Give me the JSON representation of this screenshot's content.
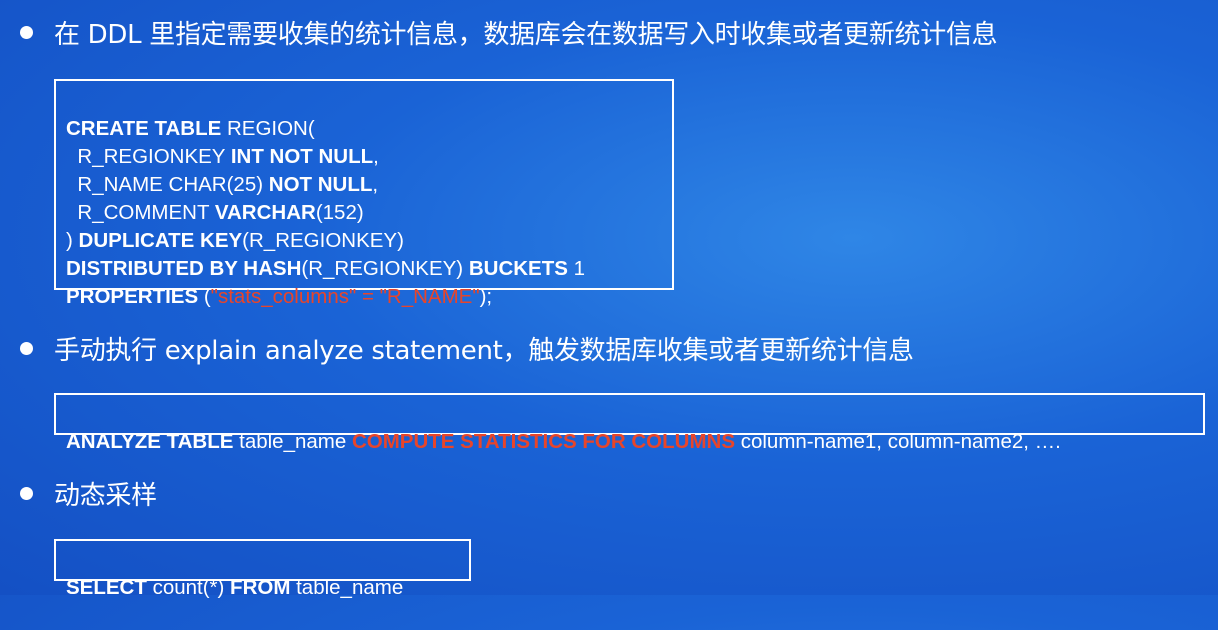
{
  "bullets": [
    "在 DDL 里指定需要收集的统计信息，数据库会在数据写入时收集或者更新统计信息",
    "手动执行 explain analyze statement，触发数据库收集或者更新统计信息",
    "动态采样"
  ],
  "ddl": {
    "l1_kw": "CREATE TABLE",
    "l1_rest": " REGION(",
    "l2_pre": "  R_REGIONKEY ",
    "l2_kw": "INT NOT NULL",
    "l2_post": ",",
    "l3_pre": "  R_NAME CHAR(25) ",
    "l3_kw": "NOT NULL",
    "l3_post": ",",
    "l4_pre": "  R_COMMENT ",
    "l4_kw": "VARCHAR",
    "l4_post": "(152)",
    "l5_pre": ") ",
    "l5_kw": "DUPLICATE KEY",
    "l5_post": "(R_REGIONKEY)",
    "l6_kw1": "DISTRIBUTED BY HASH",
    "l6_mid": "(R_REGIONKEY) ",
    "l6_kw2": "BUCKETS",
    "l6_post": " 1",
    "l7_kw": "PROPERTIES",
    "l7_pre": " (",
    "l7_red": "\"stats_columns\" = \"R_NAME\"",
    "l7_post": ");"
  },
  "analyze": {
    "kw": "ANALYZE TABLE",
    "mid": " table_name ",
    "red": "COMPUTE STATISTICS FOR COLUMNS",
    "post": " column-name1, column-name2, …."
  },
  "sample": {
    "kw1": "SELECT",
    "mid": " count(*) ",
    "kw2": "FROM",
    "post": " table_name"
  }
}
